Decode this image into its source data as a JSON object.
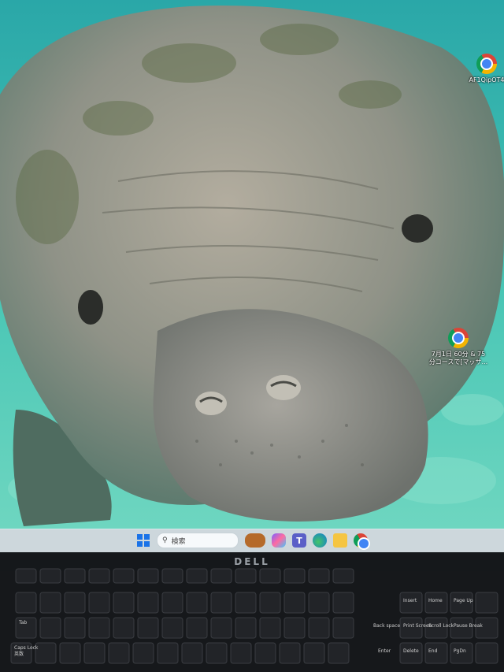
{
  "desktop": {
    "icons": [
      {
        "name": "chrome-shortcut",
        "label": "AF1QipOT4"
      },
      {
        "name": "chrome-shortcut",
        "label": "7月1日 60分 & 75\n分コースで[マッサ..."
      }
    ]
  },
  "taskbar": {
    "search_placeholder": "検索",
    "apps": [
      "start",
      "search",
      "widgets-game",
      "copilot",
      "teams",
      "edge",
      "file-explorer",
      "chrome"
    ]
  },
  "monitor": {
    "brand": "DELL"
  },
  "keyboard": {
    "key_labels": [
      "Tab",
      "Caps Lock",
      "英数",
      "Insert",
      "Home",
      "Page Up",
      "Delete",
      "End",
      "PgDn",
      "Back space",
      "Enter",
      "Print Screen",
      "Scroll Lock",
      "Pause Break"
    ]
  },
  "colors": {
    "water": "#3fbfb3",
    "manatee": "#8f9287",
    "taskbar": "#dfe8ee",
    "bezel": "#15181b"
  }
}
